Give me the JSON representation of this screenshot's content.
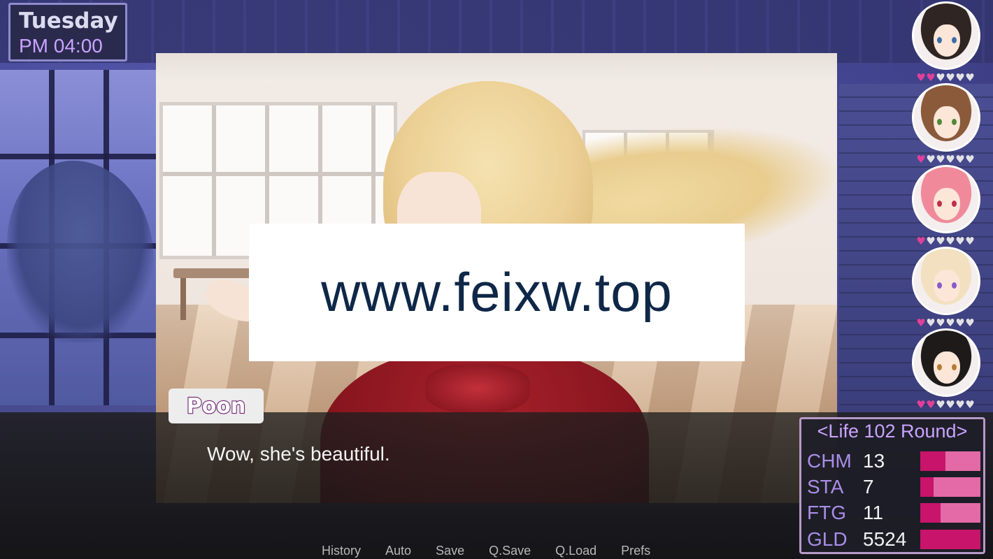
{
  "clock": {
    "day": "Tuesday",
    "time": "PM 04:00"
  },
  "watermark": {
    "text": "www.feixw.top"
  },
  "dialogue": {
    "speaker": "Poon",
    "text": "Wow, she's beautiful."
  },
  "quick_menu": [
    {
      "label": "History"
    },
    {
      "label": "Auto"
    },
    {
      "label": "Save"
    },
    {
      "label": "Q.Save"
    },
    {
      "label": "Q.Load"
    },
    {
      "label": "Prefs"
    }
  ],
  "characters": [
    {
      "hair_color": "#2f2623",
      "eye_color": "#3a6fa8",
      "affection": 2,
      "max": 6
    },
    {
      "hair_color": "#8b5a3a",
      "eye_color": "#4f8a3a",
      "affection": 1,
      "max": 6
    },
    {
      "hair_color": "#f08a9a",
      "eye_color": "#c0304a",
      "affection": 1,
      "max": 6
    },
    {
      "hair_color": "#f2e0c0",
      "eye_color": "#8a5ac8",
      "affection": 1,
      "max": 6
    },
    {
      "hair_color": "#1e1a1a",
      "eye_color": "#b87a30",
      "affection": 2,
      "max": 6
    }
  ],
  "stats": {
    "title": "<Life 102 Round>",
    "rows": [
      {
        "label": "CHM",
        "value": "13",
        "fill": 0.42
      },
      {
        "label": "STA",
        "value": "7",
        "fill": 0.22
      },
      {
        "label": "FTG",
        "value": "11",
        "fill": 0.34
      },
      {
        "label": "GLD",
        "value": "5524",
        "fill": 1.0
      }
    ]
  },
  "colors": {
    "heart_filled": "#e0409a",
    "heart_empty": "#e2e2e6",
    "accent_purple": "#c9a3ff",
    "bar_bg": "#e36aa6",
    "bar_fill": "#c8146a"
  }
}
